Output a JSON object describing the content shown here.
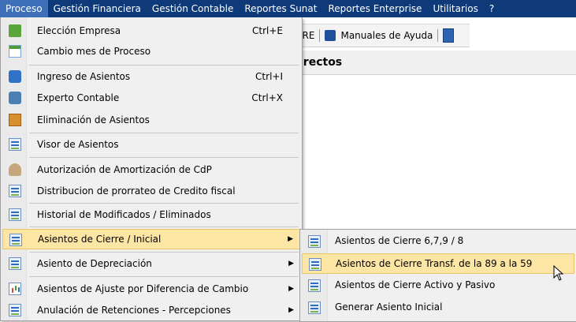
{
  "menubar": {
    "items": [
      {
        "label": "Proceso"
      },
      {
        "label": "Gestión Financiera"
      },
      {
        "label": "Gestión Contable"
      },
      {
        "label": "Reportes Sunat"
      },
      {
        "label": "Reportes Enterprise"
      },
      {
        "label": "Utilitarios"
      },
      {
        "label": "?"
      }
    ]
  },
  "background": {
    "toolbar_fragment": "IRE",
    "manuals_label": "Manuales de Ayuda",
    "panel_title_fragment": "irectos"
  },
  "proceso_menu": {
    "items": [
      {
        "label": "Elección Empresa",
        "shortcut": "Ctrl+E",
        "icon": "company-icon"
      },
      {
        "label": "Cambio mes de Proceso",
        "shortcut": "",
        "icon": "calendar-icon"
      },
      {
        "label": "Ingreso de Asientos",
        "shortcut": "Ctrl+I",
        "icon": "entry-icon"
      },
      {
        "label": "Experto Contable",
        "shortcut": "Ctrl+X",
        "icon": "expert-icon"
      },
      {
        "label": "Eliminación de Asientos",
        "shortcut": "",
        "icon": "clipboard-icon"
      },
      {
        "label": "Visor de Asientos",
        "shortcut": "",
        "icon": "form-icon"
      },
      {
        "label": "Autorización de Amortización de CdP",
        "shortcut": "",
        "icon": "person-icon"
      },
      {
        "label": "Distribucion de prorrateo de Credito fiscal",
        "shortcut": "",
        "icon": "form-icon"
      },
      {
        "label": "Historial de Modificados / Eliminados",
        "shortcut": "",
        "icon": "form-icon"
      },
      {
        "label": "Asientos de Cierre / Inicial",
        "shortcut": "",
        "icon": "form-icon",
        "submenu": true,
        "highlighted": true
      },
      {
        "label": "Asiento de Depreciación",
        "shortcut": "",
        "icon": "form-icon",
        "submenu": true
      },
      {
        "label": "Asientos de Ajuste por Diferencia de Cambio",
        "shortcut": "",
        "icon": "chart-icon",
        "submenu": true
      },
      {
        "label": "Anulación de Retenciones - Percepciones",
        "shortcut": "",
        "icon": "form-icon",
        "submenu": true
      }
    ]
  },
  "submenu": {
    "items": [
      {
        "label": "Asientos de Cierre 6,7,9 / 8"
      },
      {
        "label": "Asientos de Cierre Transf. de la 89 a la 59",
        "highlighted": true
      },
      {
        "label": "Asientos de Cierre Activo y Pasivo"
      },
      {
        "label": "Generar Asiento Inicial"
      }
    ]
  },
  "colors": {
    "menubar": "#0e3a7a",
    "highlight": "#fde6a3",
    "menu_bg": "#f0f0f0"
  }
}
